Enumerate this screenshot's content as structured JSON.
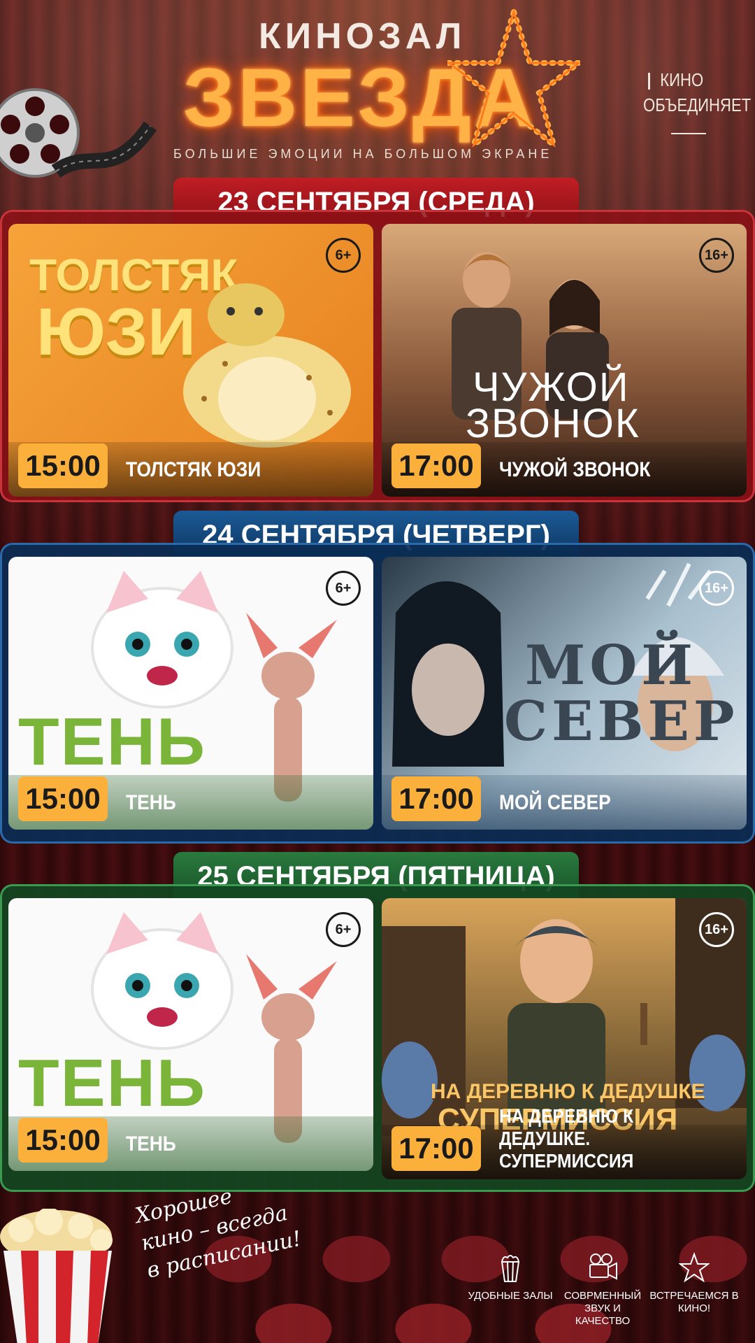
{
  "header": {
    "kinozal": "КИНОЗАЛ",
    "brand": "ЗВЕЗДА",
    "tagline": "БОЛЬШИЕ ЭМОЦИИ НА БОЛЬШОМ ЭКРАНЕ",
    "slogan_line1": "КИНО",
    "slogan_line2": "ОБЪЕДИНЯЕТ"
  },
  "days": [
    {
      "date": "23 СЕНТЯБРЯ (СРЕДА)",
      "color": "#a3161c",
      "shows": [
        {
          "time": "15:00",
          "title": "ТОЛСТЯК ЮЗИ",
          "age": "6+",
          "poster_line1": "ТОЛСТЯК",
          "poster_line2": "ЮЗИ"
        },
        {
          "time": "17:00",
          "title": "ЧУЖОЙ ЗВОНОК",
          "age": "16+",
          "poster_line1": "ЧУЖОЙ",
          "poster_line2": "ЗВОНОК"
        }
      ]
    },
    {
      "date": "24 СЕНТЯБРЯ (ЧЕТВЕРГ)",
      "color": "#0f3f6e",
      "shows": [
        {
          "time": "15:00",
          "title": "ТЕНЬ",
          "age": "6+",
          "poster_line1": "ТЕНЬ"
        },
        {
          "time": "17:00",
          "title": "МОЙ СЕВЕР",
          "age": "16+",
          "poster_line1": "МОЙ",
          "poster_line2": "СЕВЕР"
        }
      ]
    },
    {
      "date": "25 СЕНТЯБРЯ (ПЯТНИЦА)",
      "color": "#1d5a2c",
      "shows": [
        {
          "time": "15:00",
          "title": "ТЕНЬ",
          "age": "6+",
          "poster_line1": "ТЕНЬ"
        },
        {
          "time": "17:00",
          "title": "НА ДЕРЕВНЮ К ДЕДУШКЕ. СУПЕРМИССИЯ",
          "age": "16+",
          "poster_line1": "НА ДЕРЕВНЮ К ДЕДУШКЕ",
          "poster_line2": "СУПЕРМИССИЯ"
        }
      ]
    }
  ],
  "footer": {
    "handwrite_line1": "Хорошее",
    "handwrite_line2": "кино – всегда",
    "handwrite_line3": "в расписании!",
    "features": [
      {
        "icon": "popcorn-icon",
        "label": "УДОБНЫЕ ЗАЛЫ"
      },
      {
        "icon": "film-camera-icon",
        "label": "СОВРМЕННЫЙ ЗВУК И КАЧЕСТВО"
      },
      {
        "icon": "star-icon",
        "label": "ВСТРЕЧАЕМСЯ В КИНО!"
      }
    ]
  },
  "colors": {
    "accent": "#fbb03b",
    "brand_glow": "#ff7a1a",
    "background": "#2a0608"
  }
}
